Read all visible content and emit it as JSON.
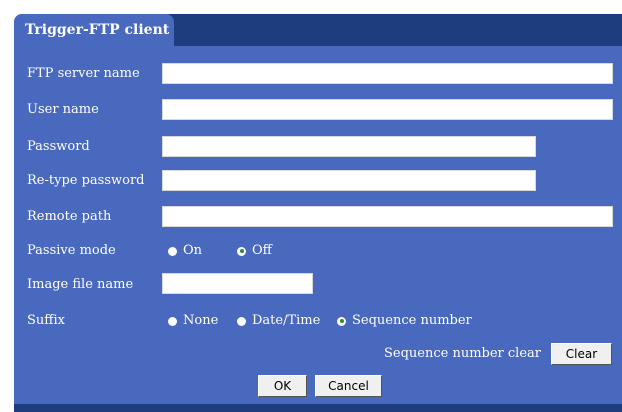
{
  "tab": {
    "title": "Trigger-FTP client"
  },
  "fields": {
    "ftp_server_name": {
      "label": "FTP server name",
      "value": ""
    },
    "user_name": {
      "label": "User name",
      "value": ""
    },
    "password": {
      "label": "Password",
      "value": ""
    },
    "retype_password": {
      "label": "Re-type password",
      "value": ""
    },
    "remote_path": {
      "label": "Remote path",
      "value": ""
    },
    "image_file_name": {
      "label": "Image file name",
      "value": ""
    }
  },
  "passive_mode": {
    "label": "Passive mode",
    "options": [
      "On",
      "Off"
    ],
    "selected": "Off"
  },
  "suffix": {
    "label": "Suffix",
    "options": [
      "None",
      "Date/Time",
      "Sequence number"
    ],
    "selected": "Sequence number"
  },
  "sequence_clear": {
    "label": "Sequence number clear",
    "button": "Clear"
  },
  "buttons": {
    "ok": "OK",
    "cancel": "Cancel"
  },
  "colors": {
    "panel": "#4969be",
    "frame": "#1e3d7e",
    "radio_selected": "#2f8d2f"
  }
}
